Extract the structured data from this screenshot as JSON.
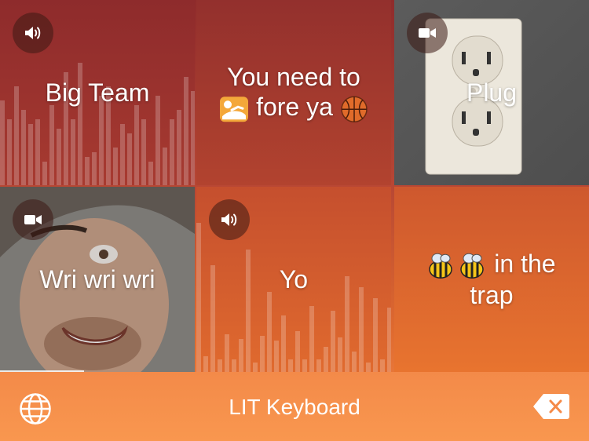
{
  "app": {
    "keyboard_title": "LIT Keyboard"
  },
  "tiles": [
    {
      "caption": "Big Team",
      "media": "audio",
      "badge_icon": "speaker-icon"
    },
    {
      "caption_line1": "You need to",
      "caption_line2": "fore ya",
      "media": "text",
      "emoji_before": "sunbather-emoji",
      "emoji_after": "basketball-emoji"
    },
    {
      "caption": "Plug",
      "media": "video",
      "badge_icon": "video-camera-icon",
      "background": "power-outlet-photo"
    },
    {
      "caption": "Wri wri wri",
      "media": "video",
      "badge_icon": "video-camera-icon",
      "background": "face-photo"
    },
    {
      "caption": "Yo",
      "media": "audio",
      "badge_icon": "speaker-icon"
    },
    {
      "caption_emojis": "🐝🐝",
      "caption_line1": " in the",
      "caption_line2": "trap",
      "media": "text"
    }
  ],
  "colors": {
    "accent": "#f58a48",
    "text": "#ffffff"
  },
  "icons": {
    "left": "globe-icon",
    "right": "backspace-icon"
  }
}
